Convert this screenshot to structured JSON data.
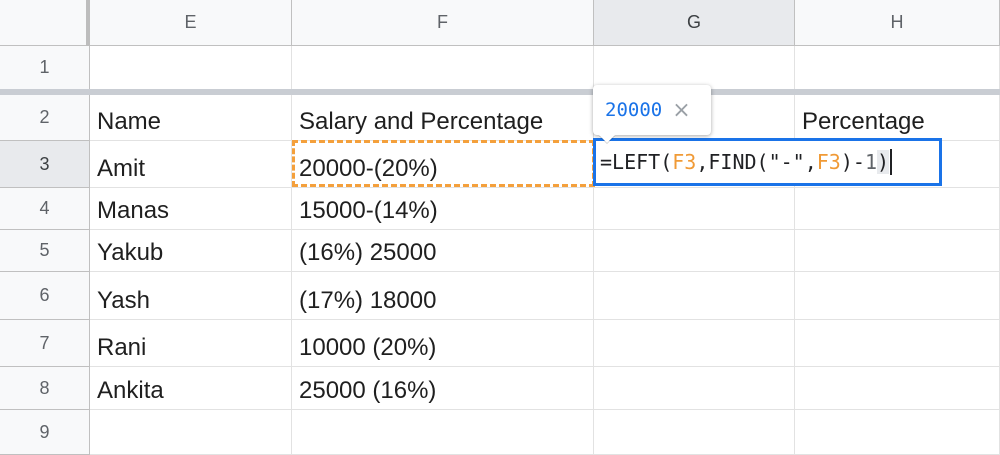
{
  "columns": [
    "E",
    "F",
    "G",
    "H"
  ],
  "rows": [
    "1",
    "2",
    "3",
    "4",
    "5",
    "6",
    "7",
    "8",
    "9"
  ],
  "cells": {
    "E2": "Name",
    "F2": "Salary and Percentage",
    "H2": "Percentage",
    "E3": "Amit",
    "F3": "20000-(20%)",
    "E4": "Manas",
    "F4": "15000-(14%)",
    "E5": "Yakub",
    "F5": "(16%) 25000",
    "E6": "Yash",
    "F6": "(17%) 18000",
    "E7": "Rani",
    "F7": "10000 (20%)",
    "E8": "Ankita",
    "F8": "25000 (16%)"
  },
  "formula_editor": {
    "prefix": "=LEFT(",
    "ref1": "F3",
    "mid": ",FIND(\"-\",",
    "ref2": "F3",
    "close1": ")-",
    "num": "1",
    "close2": ")"
  },
  "preview_tooltip": {
    "value": "20000",
    "close_symbol": "×"
  },
  "colors": {
    "editor_border": "#1a73e8",
    "copy_range_border": "#f4a03c",
    "reference_text": "#f09a36"
  }
}
